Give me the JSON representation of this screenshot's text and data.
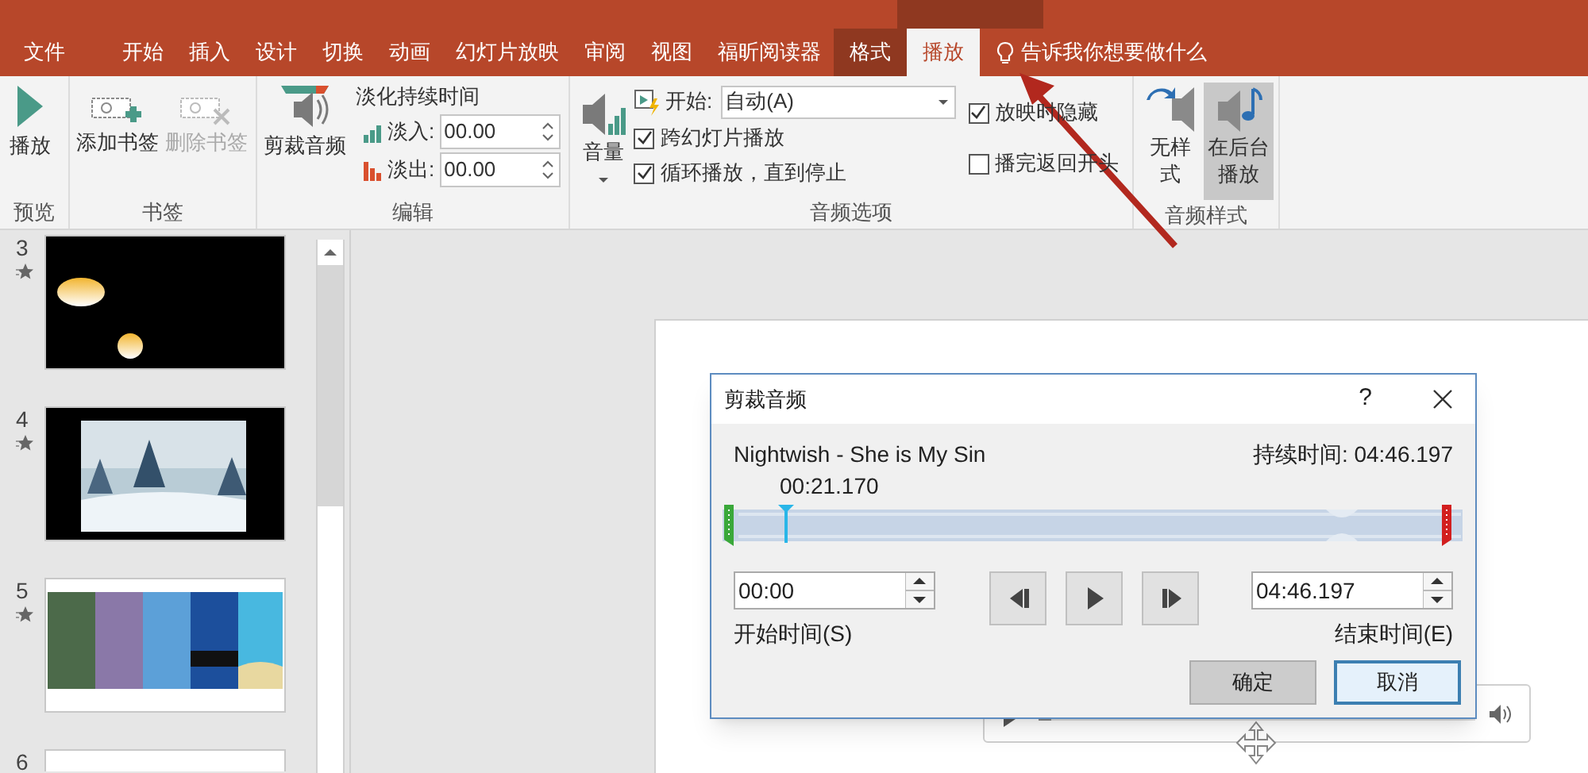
{
  "tabs": [
    {
      "label": "文件",
      "selected": false,
      "kind": "file"
    },
    {
      "label": "开始",
      "selected": false,
      "kind": "normal"
    },
    {
      "label": "插入",
      "selected": false,
      "kind": "normal"
    },
    {
      "label": "设计",
      "selected": false,
      "kind": "normal"
    },
    {
      "label": "切换",
      "selected": false,
      "kind": "normal"
    },
    {
      "label": "动画",
      "selected": false,
      "kind": "normal"
    },
    {
      "label": "幻灯片放映",
      "selected": false,
      "kind": "normal"
    },
    {
      "label": "审阅",
      "selected": false,
      "kind": "normal"
    },
    {
      "label": "视图",
      "selected": false,
      "kind": "normal"
    },
    {
      "label": "福昕阅读器",
      "selected": false,
      "kind": "normal"
    },
    {
      "label": "格式",
      "selected": false,
      "kind": "contextual"
    },
    {
      "label": "播放",
      "selected": true,
      "kind": "contextual"
    }
  ],
  "tell_me": "告诉我你想要做什么",
  "ribbon": {
    "play": "播放",
    "preview_group": "预览",
    "add_bookmark": {
      "label": "添加书签",
      "disabled": false
    },
    "remove_bookmark": {
      "label": "删除书签",
      "disabled": true
    },
    "bookmark_group": "书签",
    "trim_audio": "剪裁音频",
    "fade_title": "淡化持续时间",
    "fade_in": {
      "label": "淡入:",
      "value": "00.00"
    },
    "fade_out": {
      "label": "淡出:",
      "value": "00.00"
    },
    "edit_group": "编辑",
    "volume": "音量",
    "start": {
      "label": "开始:",
      "value": "自动(A)"
    },
    "options": [
      {
        "label": "跨幻灯片播放",
        "checked": true
      },
      {
        "label": "循环播放，直到停止",
        "checked": true
      },
      {
        "label": "放映时隐藏",
        "checked": true
      },
      {
        "label": "播完返回开头",
        "checked": false
      }
    ],
    "options_group": "音频选项",
    "styles": [
      {
        "label": "无样式",
        "selected": false,
        "kind": "none"
      },
      {
        "label": "在后台播放",
        "selected": true,
        "kind": "background"
      }
    ],
    "styles_group": "音频样式"
  },
  "slides": [
    {
      "number": "3",
      "animated": true,
      "kind": "orbs"
    },
    {
      "number": "4",
      "animated": true,
      "kind": "snow"
    },
    {
      "number": "5",
      "animated": true,
      "kind": "collage"
    },
    {
      "number": "6",
      "animated": false,
      "kind": "blank"
    }
  ],
  "dialog": {
    "title": "剪裁音频",
    "help": "?",
    "track_name": "Nightwish - She is My Sin",
    "duration": "持续时间: 04:46.197",
    "playhead_time": "00:21.170",
    "playhead": {
      "level": 0.074
    },
    "start_time": {
      "value": "00:00",
      "label": "开始时间(S)"
    },
    "end_time": {
      "value": "04:46.197",
      "label": "结束时间(E)"
    },
    "buttons": [
      {
        "label": "确定",
        "kind": "plain"
      },
      {
        "label": "取消",
        "kind": "default"
      }
    ]
  }
}
